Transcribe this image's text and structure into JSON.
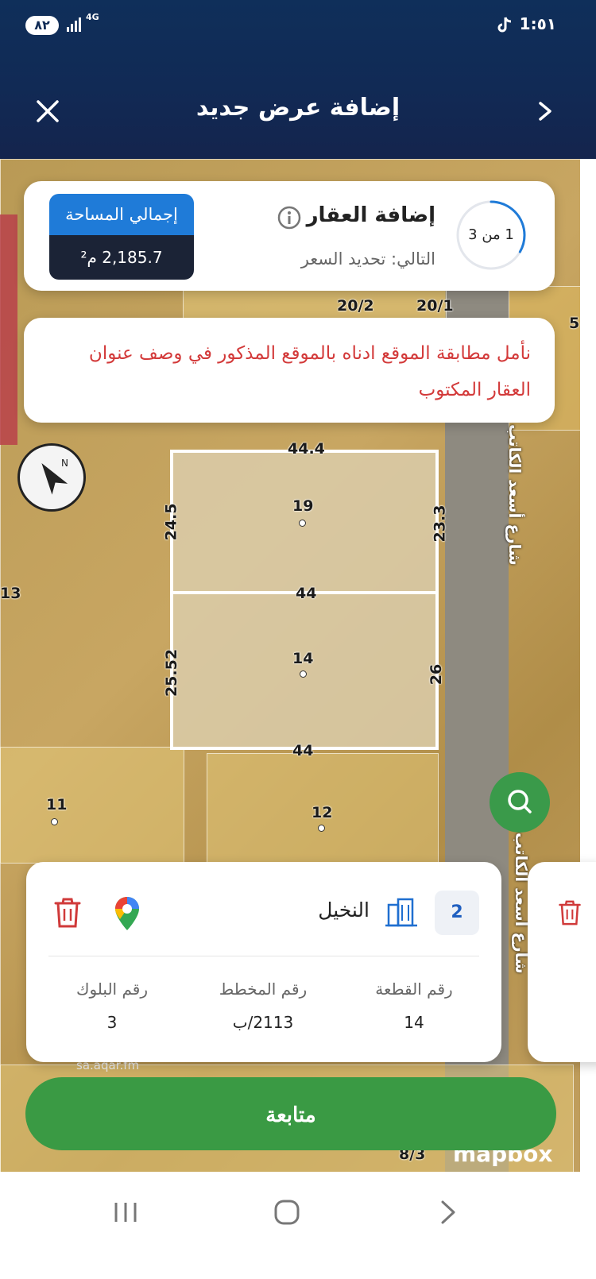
{
  "status_bar": {
    "battery": "٨٢",
    "network": "4G",
    "time": "1:٥١"
  },
  "header": {
    "title": "إضافة عرض جديد"
  },
  "step_card": {
    "progress": "1 من 3",
    "progress_fraction": 0.333,
    "title": "إضافة العقار",
    "next": "التالي: تحديد السعر",
    "area_label": "إجمالي المساحة",
    "area_value": "2,185.7 م²"
  },
  "notice": {
    "text": "نأمل مطابقة الموقع ادناه بالموقع المذكور في وصف عنوان العقار المكتوب"
  },
  "map": {
    "labels": {
      "lot_top_width": "44.4",
      "lot_19": "19",
      "lot_14": "14",
      "lot_divider_width": "44",
      "lot_bottom_width": "44",
      "lot_left_upper": "24.5",
      "lot_left_lower": "25.52",
      "lot_right_upper": "23.3",
      "lot_right_lower": "26",
      "plot_20_2": "20/2",
      "plot_20_1": "20/1",
      "plot_11": "11",
      "plot_12": "12",
      "plot_13": "13",
      "plot_8_3": "8/3",
      "edge_5": "5"
    },
    "street_name": "شارع أسعد الكاتب",
    "watermark": "sa.aqar.fm",
    "attribution": "mapbox"
  },
  "property": {
    "index": "2",
    "district": "النخيل",
    "plot_label": "رقم القطعة",
    "plot_value": "14",
    "plan_label": "رقم المخطط",
    "plan_value": "2113/ب",
    "block_label": "رقم البلوك",
    "block_value": "3"
  },
  "actions": {
    "continue": "متابعة"
  },
  "colors": {
    "header": "#112a55",
    "accent_blue": "#1f7bd8",
    "success_green": "#3a9a44",
    "notice_red": "#d33a3a",
    "trash_red": "#d03a3a"
  }
}
